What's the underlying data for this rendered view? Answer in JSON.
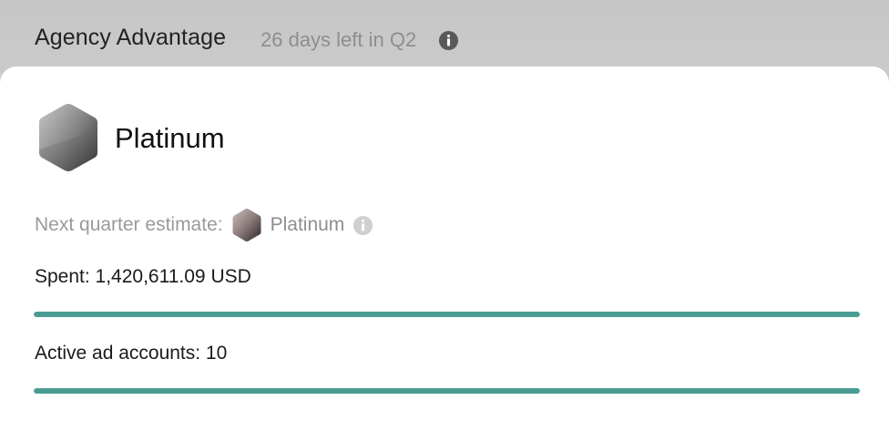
{
  "header": {
    "title": "Agency Advantage",
    "days_left": "26 days left in Q2",
    "info_icon": "info-icon"
  },
  "tier": {
    "icon": "platinum-hexagon-icon",
    "name": "Platinum"
  },
  "estimate": {
    "label": "Next quarter estimate:",
    "icon": "platinum-hexagon-icon",
    "tier": "Platinum",
    "info_icon": "info-icon"
  },
  "metrics": {
    "spent": {
      "label": "Spent: 1,420,611.09 USD",
      "progress": 1.0
    },
    "accounts": {
      "label": "Active ad accounts: 10",
      "progress": 1.0
    }
  },
  "colors": {
    "progress_fill": "#4a9c92",
    "header_bg": "#c6c6c6",
    "card_bg": "#ffffff"
  }
}
